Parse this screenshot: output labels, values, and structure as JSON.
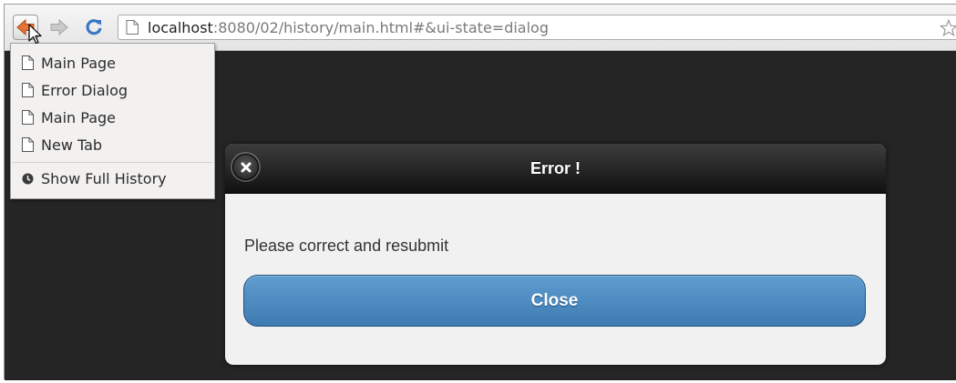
{
  "browser": {
    "address": {
      "host": "localhost",
      "rest": ":8080/02/history/main.html#&ui-state=dialog"
    }
  },
  "history_menu": {
    "items": [
      {
        "label": "Main Page",
        "icon": "page-icon"
      },
      {
        "label": "Error Dialog",
        "icon": "page-icon"
      },
      {
        "label": "Main Page",
        "icon": "page-icon"
      },
      {
        "label": "New Tab",
        "icon": "page-icon"
      }
    ],
    "show_full_history": {
      "label": "Show Full History",
      "icon": "clock-icon"
    }
  },
  "dialog": {
    "title": "Error !",
    "message": "Please correct and resubmit",
    "close_button": "Close"
  },
  "colors": {
    "page_background": "#252525",
    "dialog_button": "#4a88bf",
    "back_arrow": "#e8733a",
    "reload": "#3b77c4"
  }
}
